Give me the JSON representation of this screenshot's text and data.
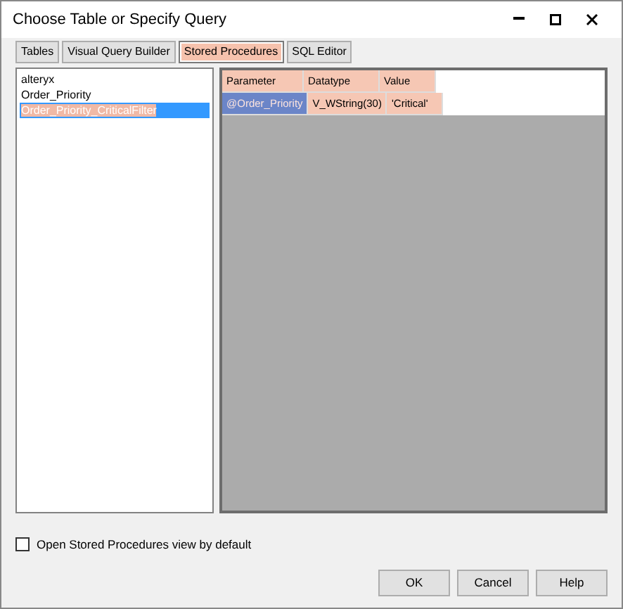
{
  "window": {
    "title": "Choose Table or Specify Query"
  },
  "tabs": [
    {
      "label": "Tables",
      "selected": false,
      "highlighted": false
    },
    {
      "label": "Visual Query Builder",
      "selected": false,
      "highlighted": false
    },
    {
      "label": "Stored Procedures",
      "selected": true,
      "highlighted": true
    },
    {
      "label": "SQL Editor",
      "selected": false,
      "highlighted": false
    }
  ],
  "procedures": [
    {
      "name": "alteryx",
      "selected": false,
      "highlighted": false
    },
    {
      "name": "Order_Priority",
      "selected": false,
      "highlighted": false
    },
    {
      "name": "Order_Priority_CriticalFilter",
      "selected": true,
      "highlighted": true
    }
  ],
  "grid": {
    "columns": [
      {
        "label": "Parameter",
        "highlighted": true
      },
      {
        "label": "Datatype",
        "highlighted": true
      },
      {
        "label": "Value",
        "highlighted": true
      }
    ],
    "rows": [
      {
        "cells": [
          {
            "text": "@Order_Priority",
            "selected": true,
            "highlighted": true
          },
          {
            "text": "V_WString(30)",
            "selected": false,
            "highlighted": true
          },
          {
            "text": "'Critical'",
            "selected": false,
            "highlighted": true
          }
        ]
      }
    ]
  },
  "default_view": {
    "label": "Open Stored Procedures view by default",
    "checked": false
  },
  "buttons": [
    "OK",
    "Cancel",
    "Help"
  ]
}
